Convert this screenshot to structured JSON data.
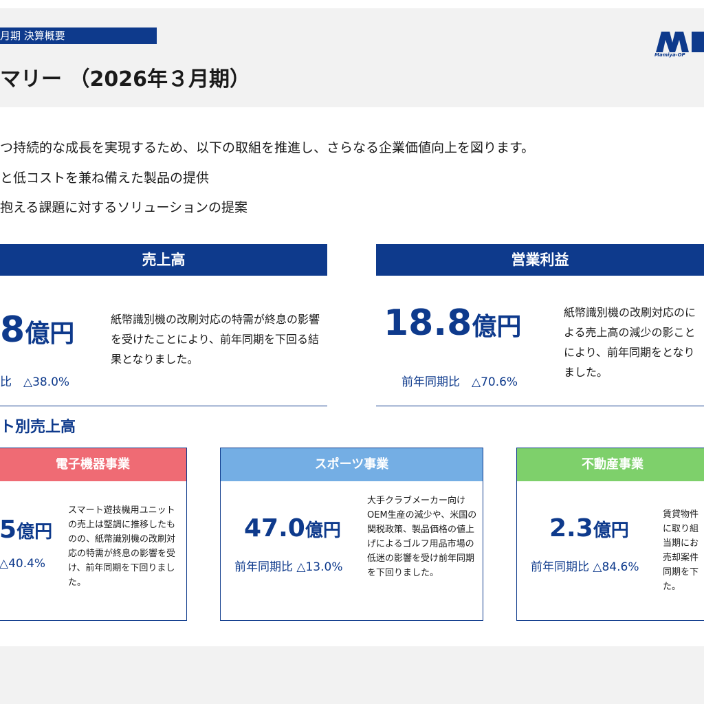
{
  "header": {
    "subtitle": "月期 決算概要",
    "title": "マリー （2026年３月期）",
    "logo_text": "Mamiya-OP"
  },
  "intro": {
    "lead": "つ持続的な成長を実現するため、以下の取組を推進し、さらなる企業価値向上を図ります。",
    "bullets": [
      "と低コストを兼ね備えた製品の提供",
      "抱える課題に対するソリューションの提案"
    ]
  },
  "kpis": {
    "sales": {
      "label": "売上高",
      "value": "8",
      "unit": "億円",
      "yoy": "比　△38.0%",
      "desc": "紙幣識別機の改刷対応の特需が終息の影響を受けたことにより、前年同期を下回る結果となりました。"
    },
    "operating_profit": {
      "label": "営業利益",
      "value": "18.8",
      "unit": "億円",
      "yoy": "前年同期比　△70.6%",
      "desc": "紙幣識別機の改刷対応のによる売上高の減少の影ことにより、前年同期をとなりました。"
    }
  },
  "segments_title": "ト別売上高",
  "segments": [
    {
      "label": "電子機器事業",
      "value": "5",
      "unit": "億円",
      "yoy": "△40.4%",
      "desc": "スマート遊技機用ユニットの売上は堅調に推移したものの、紙幣識別機の改刷対応の特需が終息の影響を受け、前年同期を下回りました。",
      "color": "#ef6b74"
    },
    {
      "label": "スポーツ事業",
      "value": "47.0",
      "unit": "億円",
      "yoy": "前年同期比 △13.0%",
      "desc": "大手クラブメーカー向けOEM生産の減少や、米国の関税政策、製品価格の値上げによるゴルフ用品市場の低迷の影響を受け前年同期を下回りました。",
      "color": "#74aee4"
    },
    {
      "label": "不動産事業",
      "value": "2.3",
      "unit": "億円",
      "yoy": "前年同期比 △84.6%",
      "desc": "賃貸物件に取り組当期にお売却案件同期を下た。",
      "color": "#7ed06b"
    }
  ],
  "colors": {
    "brand": "#0e3a8c",
    "panel_bg": "#f2f2f2"
  }
}
